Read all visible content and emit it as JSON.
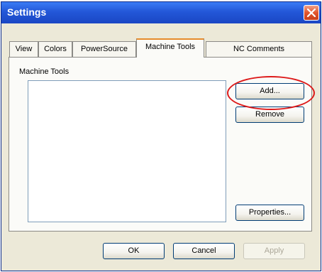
{
  "window": {
    "title": "Settings"
  },
  "titlebar": {
    "close_icon": "close-icon"
  },
  "tabs": [
    {
      "label": "View",
      "active": false
    },
    {
      "label": "Colors",
      "active": false
    },
    {
      "label": "PowerSource",
      "active": false
    },
    {
      "label": "Machine Tools",
      "active": true
    },
    {
      "label": "NC Comments",
      "active": false
    }
  ],
  "machine_tools": {
    "group_label": "Machine Tools",
    "items": [],
    "add_label": "Add...",
    "remove_label": "Remove",
    "properties_label": "Properties..."
  },
  "footer": {
    "ok_label": "OK",
    "cancel_label": "Cancel",
    "apply_label": "Apply",
    "apply_enabled": false
  },
  "colors": {
    "titlebar": "#2357d8",
    "close_button": "#e2552d",
    "annotation_circle": "#dd1a1a",
    "active_tab_accent": "#e68b2c"
  }
}
